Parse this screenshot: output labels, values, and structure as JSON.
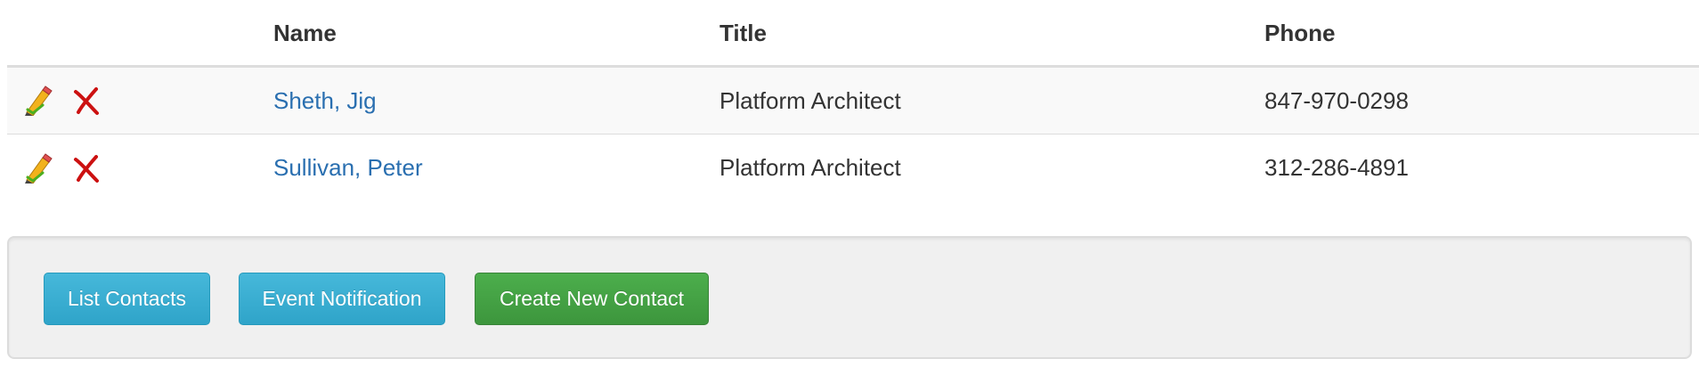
{
  "table": {
    "headers": {
      "actions": "",
      "name": "Name",
      "title": "Title",
      "phone": "Phone"
    },
    "rows": [
      {
        "name": "Sheth, Jig",
        "title": "Platform Architect",
        "phone": "847-970-0298",
        "edit_icon": "pencil-edit-icon",
        "delete_icon": "red-x-delete-icon"
      },
      {
        "name": "Sullivan, Peter",
        "title": "Platform Architect",
        "phone": "312-286-4891",
        "edit_icon": "pencil-edit-icon",
        "delete_icon": "red-x-delete-icon"
      }
    ]
  },
  "actions": {
    "list_contacts": "List Contacts",
    "event_notification": "Event Notification",
    "create_new_contact": "Create New Contact"
  },
  "colors": {
    "link": "#2a6fb0",
    "info_button": "#2fa4c9",
    "success_button": "#449d44",
    "delete_icon": "#cc1111",
    "edit_icon_pencil": "#e8a818",
    "edit_icon_check": "#4caf20"
  }
}
